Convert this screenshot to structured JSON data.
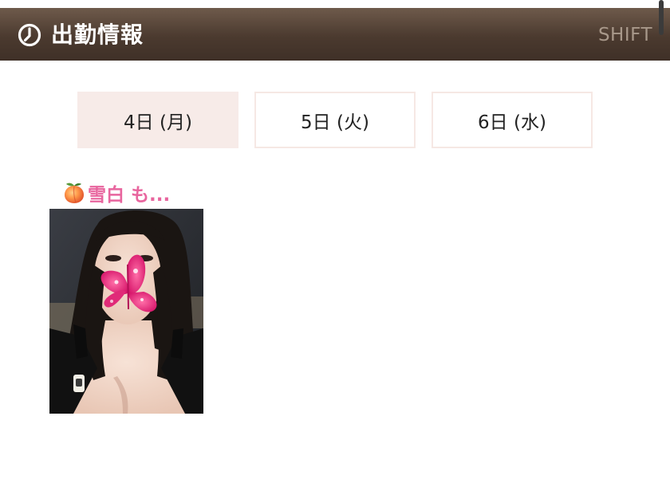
{
  "header": {
    "title": "出勤情報",
    "right_label": "SHIFT",
    "icon": "clock-icon"
  },
  "tabs": [
    {
      "label": "4日 (月)",
      "active": true
    },
    {
      "label": "5日 (火)",
      "active": false
    },
    {
      "label": "6日 (水)",
      "active": false
    }
  ],
  "cast": {
    "name": "雪白 も...",
    "name_icon": "peach-icon",
    "photo_icon": "profile-photo"
  },
  "colors": {
    "header_bg": "#4b3a2f",
    "header_title": "#ffffff",
    "header_right": "#a8988a",
    "tab_active_bg": "#f7ebe8",
    "tab_border": "#f6e8e4",
    "cast_name": "#e8659e"
  }
}
